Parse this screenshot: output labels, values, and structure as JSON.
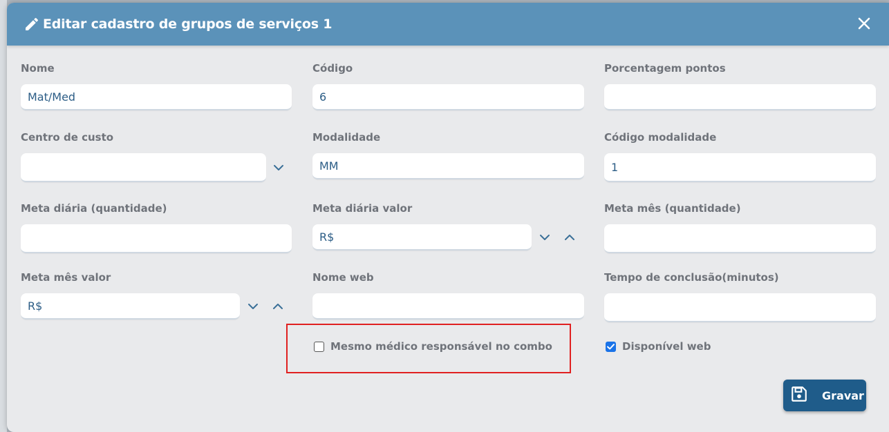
{
  "modal": {
    "title": "Editar cadastro de grupos de serviços 1"
  },
  "fields": {
    "nome": {
      "label": "Nome",
      "value": "Mat/Med"
    },
    "codigo": {
      "label": "Código",
      "value": "6"
    },
    "porcentagem_pontos": {
      "label": "Porcentagem pontos",
      "value": ""
    },
    "centro_custo": {
      "label": "Centro de custo",
      "value": ""
    },
    "modalidade": {
      "label": "Modalidade",
      "value": "MM"
    },
    "codigo_modalidade": {
      "label": "Código modalidade",
      "value": "1"
    },
    "meta_diaria_qtd": {
      "label": "Meta diária (quantidade)",
      "value": ""
    },
    "meta_diaria_valor": {
      "label": "Meta diária valor",
      "value": "R$"
    },
    "meta_mes_qtd": {
      "label": "Meta mês (quantidade)",
      "value": ""
    },
    "meta_mes_valor": {
      "label": "Meta mês valor",
      "value": "R$"
    },
    "nome_web": {
      "label": "Nome web",
      "value": ""
    },
    "tempo_conclusao": {
      "label": "Tempo de conclusão(minutos)",
      "value": ""
    }
  },
  "checkboxes": {
    "mesmo_medico": {
      "label": "Mesmo médico responsável no combo",
      "checked": false
    },
    "disponivel_web": {
      "label": "Disponível web",
      "checked": true
    }
  },
  "actions": {
    "save_label": "Gravar"
  },
  "colors": {
    "header": "#5b92b9",
    "save_button": "#1f5c8a",
    "highlight": "#e02020",
    "checkbox_checked": "#1a73e8"
  },
  "icons": {
    "header": "pencil-icon",
    "close": "close-icon",
    "save": "floppy-disk-icon",
    "dropdown": "chevron-down-icon",
    "increment": "chevron-up-icon"
  }
}
